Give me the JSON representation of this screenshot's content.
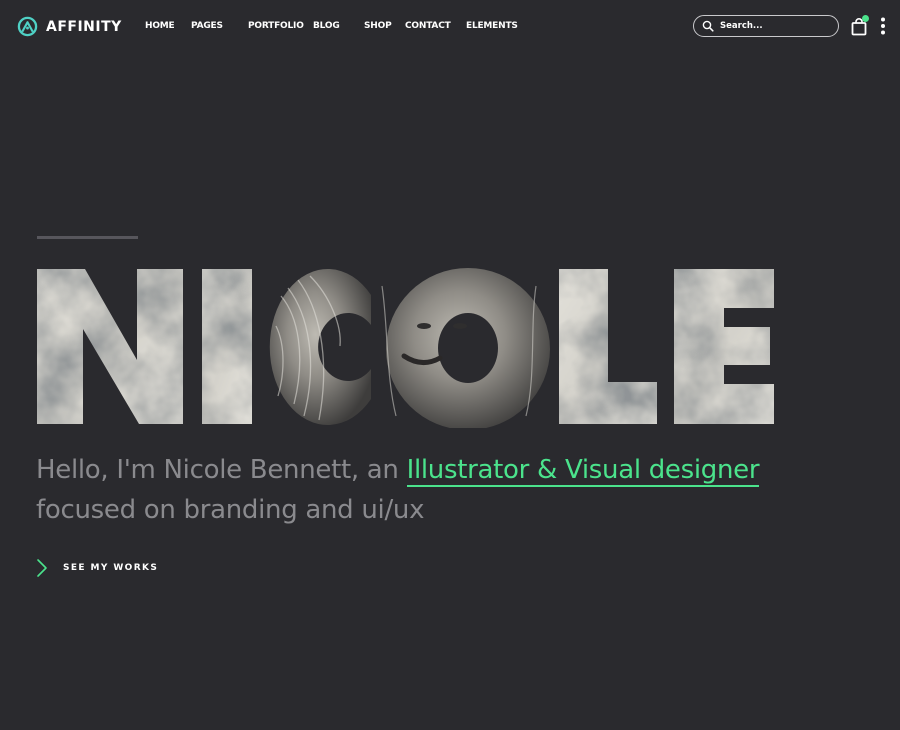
{
  "brand": {
    "name": "AFFINITY",
    "accent_color": "#4be38c",
    "logo_icon": "affinity-logo-icon"
  },
  "nav": {
    "items": [
      {
        "label": "HOME"
      },
      {
        "label": "PAGES"
      },
      {
        "label": "PORTFOLIO"
      },
      {
        "label": "BLOG"
      },
      {
        "label": "SHOP"
      },
      {
        "label": "CONTACT"
      },
      {
        "label": "ELEMENTS"
      }
    ]
  },
  "search": {
    "placeholder": "Search...",
    "icon": "search-icon"
  },
  "cart": {
    "icon": "shopping-bag-icon",
    "badge_color": "#4be38c"
  },
  "menu": {
    "icon": "more-vertical-icon"
  },
  "hero": {
    "name": "NICOLE",
    "intro": "Hello, I'm Nicole Bennett, an",
    "highlight": "Illustrator & Visual designer",
    "line2": "focused on branding and ui/ux",
    "cta_label": "SEE MY WORKS",
    "cta_icon": "chevron-right-icon"
  }
}
